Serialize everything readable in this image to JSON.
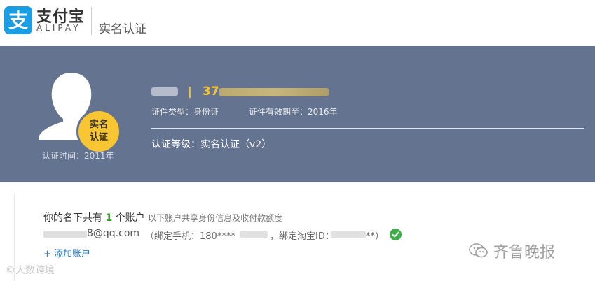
{
  "header": {
    "brand_cn": "支付宝",
    "brand_en": "ALIPAY",
    "page_title": "实名认证"
  },
  "profile": {
    "badge_label": "实名认证",
    "cert_time": "认证时间：2011年",
    "separator": "|",
    "id_prefix": "37",
    "cert_type": "证件类型：身份证",
    "cert_valid": "证件有效期至：2016年",
    "cert_level": "认证等级：实名认证（v2）"
  },
  "accounts": {
    "prefix": "你的名下共有",
    "count": "1",
    "suffix": "个账户",
    "note": "以下账户共享身份信息及收付款额度",
    "email_visible": "8@qq.com",
    "bind_phone": "（绑定手机：180****",
    "bind_taobao": "，绑定淘宝ID：",
    "taobao_tail": "**）",
    "add_account": "+ 添加账户"
  },
  "watermarks": {
    "left": "©大数跨境",
    "right": "齐鲁晚报"
  },
  "colors": {
    "band": "#64738f",
    "badge": "#f7c632",
    "accent_yellow": "#f5c632",
    "brand_blue": "#1a9de2",
    "link_blue": "#2b7ac4",
    "check_green": "#3fae4a"
  }
}
